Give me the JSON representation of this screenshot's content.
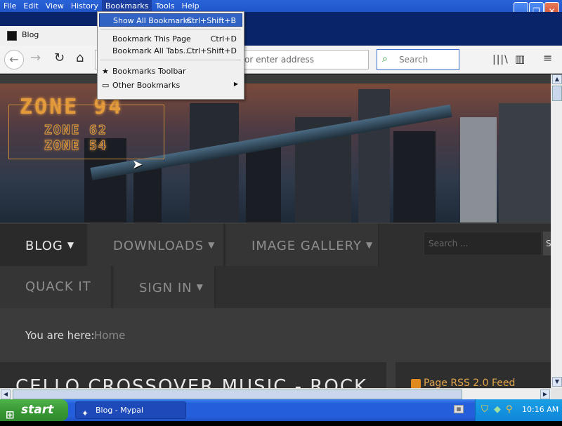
{
  "menubar": {
    "items": [
      "File",
      "Edit",
      "View",
      "History",
      "Bookmarks",
      "Tools",
      "Help"
    ],
    "active": "Bookmarks"
  },
  "tab": {
    "title": "Blog"
  },
  "toolbar": {
    "url_placeholder": "or enter address",
    "search_placeholder": "Search"
  },
  "bookmarks_menu": {
    "show_all": {
      "label": "Show All Bookmarks",
      "shortcut": "Ctrl+Shift+B"
    },
    "bookmark_page": {
      "label": "Bookmark This Page",
      "shortcut": "Ctrl+D"
    },
    "bookmark_tabs": {
      "label": "Bookmark All Tabs...",
      "shortcut": "Ctrl+Shift+D"
    },
    "toolbar": {
      "label": "Bookmarks Toolbar"
    },
    "other": {
      "label": "Other Bookmarks"
    }
  },
  "site": {
    "logo": {
      "main": "ZONE 94",
      "sub1": "ZONE 62",
      "sub2": "ZONE 54"
    },
    "nav": {
      "blog": "BLOG",
      "downloads": "DOWNLOADS",
      "gallery": "IMAGE GALLERY",
      "quack": "QUACK IT",
      "signin": "SIGN IN"
    },
    "search_placeholder": "Search ...",
    "search_button": "S",
    "breadcrumb": {
      "label": "You are here:",
      "home": "Home"
    },
    "article_title": "CELLO CROSSOVER MUSIC - ROCK",
    "rss": "Page RSS 2.0 Feed"
  },
  "taskbar": {
    "start": "start",
    "window": "Blog - Mypal",
    "clock": "10:16 AM"
  },
  "colors": {
    "xp_blue": "#245edb",
    "menu_highlight": "#3163c4",
    "site_accent": "#e29a3a",
    "start_green": "#3a9a36"
  },
  "icons": [
    "back-icon",
    "forward-icon",
    "reload-icon",
    "home-icon",
    "search-icon",
    "library-icon",
    "sidebar-icon",
    "hamburger-menu-icon",
    "bookmark-star-icon",
    "folder-icon",
    "rss-icon",
    "windows-flag-icon",
    "shield-icon",
    "network-icon",
    "magnifier-icon"
  ]
}
